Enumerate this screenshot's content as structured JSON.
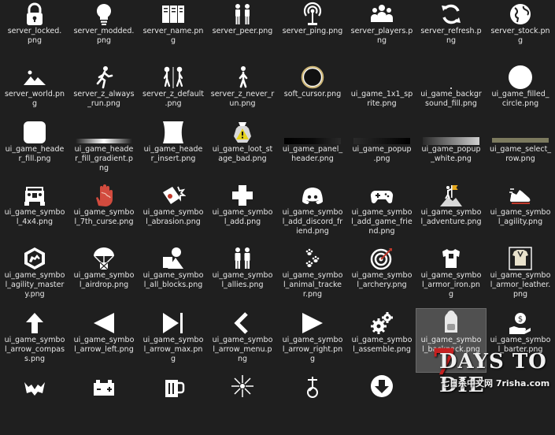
{
  "window_title": "",
  "tiles": [
    {
      "label": "server_locked.\npng",
      "icon": "lock-icon"
    },
    {
      "label": "server_modded.\npng",
      "icon": "lightbulb-icon"
    },
    {
      "label": "server_name.pn\ng",
      "icon": "server-rack-icon"
    },
    {
      "label": "server_peer.png",
      "icon": "two-people-icon"
    },
    {
      "label": "server_ping.png",
      "icon": "antenna-icon"
    },
    {
      "label": "server_players.p\nng",
      "icon": "group-icon"
    },
    {
      "label": "server_refresh.p\nng",
      "icon": "refresh-icon"
    },
    {
      "label": "server_stock.pn\ng",
      "icon": "globe-icon"
    },
    {
      "label": "server_world.pn\ng",
      "icon": "mountains-icon"
    },
    {
      "label": "server_z_always\n_run.png",
      "icon": "running-figure-icon"
    },
    {
      "label": "server_z_default\n.png",
      "icon": "walking-figures-icon"
    },
    {
      "label": "server_z_never_r\nun.png",
      "icon": "walking-figure-icon"
    },
    {
      "label": "soft_cursor.png",
      "icon": "ring-cursor-icon"
    },
    {
      "label": "ui_game_1x1_sp\nrite.png",
      "icon": "blank-sprite-icon"
    },
    {
      "label": "ui_game_backgr\nsound_fill.png",
      "icon": "dot-icon"
    },
    {
      "label": "ui_game_filled_\ncircle.png",
      "icon": "filled-circle-icon"
    },
    {
      "label": "ui_game_heade\nr_fill.png",
      "icon": "rounded-square-icon"
    },
    {
      "label": "ui_game_heade\nr_fill_gradient.p\nng",
      "icon": "gradient-bar-icon"
    },
    {
      "label": "ui_game_heade\nr_insert.png",
      "icon": "insert-shape-icon"
    },
    {
      "label": "ui_game_loot_st\nage_bad.png",
      "icon": "loot-bag-warning-icon"
    },
    {
      "label": "ui_game_panel_\nheader.png",
      "icon": "panel-header-strip-icon"
    },
    {
      "label": "ui_game_popup\n.png",
      "icon": "popup-strip-icon"
    },
    {
      "label": "ui_game_popup\n_white.png",
      "icon": "popup-white-strip-icon"
    },
    {
      "label": "ui_game_select_\nrow.png",
      "icon": "select-row-strip-icon"
    },
    {
      "label": "ui_game_symbo\nl_4x4.png",
      "icon": "jeep-icon"
    },
    {
      "label": "ui_game_symbo\nl_7th_curse.png",
      "icon": "cursed-hand-icon"
    },
    {
      "label": "ui_game_symbo\nl_abrasion.png",
      "icon": "abrasion-icon"
    },
    {
      "label": "ui_game_symbo\nl_add.png",
      "icon": "plus-icon"
    },
    {
      "label": "ui_game_symbo\nl_add_discord_fr\niend.png",
      "icon": "discord-icon"
    },
    {
      "label": "ui_game_symbo\nl_add_game_frie\nnd.png",
      "icon": "gamepad-icon"
    },
    {
      "label": "ui_game_symbo\nl_adventure.png",
      "icon": "hiker-flag-icon"
    },
    {
      "label": "ui_game_symbo\nl_agility.png",
      "icon": "sneaker-icon"
    },
    {
      "label": "ui_game_symbo\nl_agility_master\ny.png",
      "icon": "agility-mastery-icon"
    },
    {
      "label": "ui_game_symbo\nl_airdrop.png",
      "icon": "parachute-crate-icon"
    },
    {
      "label": "ui_game_symbo\nl_all_blocks.png",
      "icon": "shapes-icon"
    },
    {
      "label": "ui_game_symbo\nl_allies.png",
      "icon": "allies-icon"
    },
    {
      "label": "ui_game_symbo\nl_animal_tracke\nr.png",
      "icon": "paw-prints-icon"
    },
    {
      "label": "ui_game_symbo\nl_archery.png",
      "icon": "target-icon"
    },
    {
      "label": "ui_game_symbo\nl_armor_iron.pn\ng",
      "icon": "iron-armor-icon"
    },
    {
      "label": "ui_game_symbo\nl_armor_leather.\npng",
      "icon": "leather-armor-icon"
    },
    {
      "label": "ui_game_symbo\nl_arrow_compas\ns.png",
      "icon": "arrow-up-icon"
    },
    {
      "label": "ui_game_symbo\nl_arrow_left.png",
      "icon": "arrow-left-icon"
    },
    {
      "label": "ui_game_symbo\nl_arrow_max.pn\ng",
      "icon": "arrow-max-icon"
    },
    {
      "label": "ui_game_symbo\nl_arrow_menu.p\nng",
      "icon": "chevron-left-icon"
    },
    {
      "label": "ui_game_symbo\nl_arrow_right.pn\ng",
      "icon": "arrow-right-icon"
    },
    {
      "label": "ui_game_symbo\nl_assemble.png",
      "icon": "gears-icon"
    },
    {
      "label": "ui_game_symbo\nl_backpack.png",
      "icon": "backpack-icon"
    },
    {
      "label": "ui_game_symbo\nl_barter.png",
      "icon": "barter-icon"
    },
    {
      "label": "",
      "icon": "bat-wing-icon"
    },
    {
      "label": "",
      "icon": "battery-icon"
    },
    {
      "label": "",
      "icon": "beer-mug-icon"
    },
    {
      "label": "",
      "icon": "burst-icon"
    },
    {
      "label": "",
      "icon": "bicycle-icon"
    },
    {
      "label": "",
      "icon": "arrow-down-circle-icon"
    },
    {
      "label": "",
      "icon": "unknown-icon"
    },
    {
      "label": "",
      "icon": "unknown-icon"
    }
  ],
  "selected_index": 46,
  "watermark": {
    "seven": "7",
    "title": "DAYS TO DIE",
    "subtitle": "七日杀中文网 7risha.com"
  },
  "colors": {
    "background": "#1f1f1f",
    "selected": "#505050",
    "icon": "#ffffff",
    "watermark_red": "#c62020"
  }
}
